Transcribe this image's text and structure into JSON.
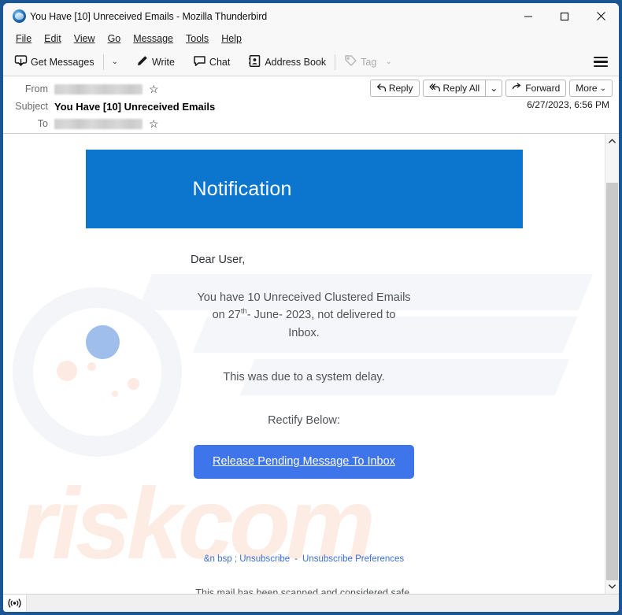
{
  "window": {
    "title": "You Have [10] Unreceived Emails - Mozilla Thunderbird",
    "app_icon": "thunderbird-icon",
    "controls": {
      "minimize": "minimize-icon",
      "maximize": "maximize-icon",
      "close": "close-icon"
    }
  },
  "menubar": {
    "items": [
      {
        "label": "File"
      },
      {
        "label": "Edit"
      },
      {
        "label": "View"
      },
      {
        "label": "Go"
      },
      {
        "label": "Message"
      },
      {
        "label": "Tools"
      },
      {
        "label": "Help"
      }
    ]
  },
  "toolbar": {
    "get_messages": "Get Messages",
    "get_messages_caret": "⌄",
    "write": "Write",
    "chat": "Chat",
    "address_book": "Address Book",
    "tag": "Tag",
    "tag_caret": "⌄",
    "app_menu": "hamburger-menu"
  },
  "message_header": {
    "from_label": "From",
    "from_value": "",
    "subject_label": "Subject",
    "subject_value": "You Have [10] Unreceived Emails",
    "to_label": "To",
    "to_value": "",
    "date": "6/27/2023, 6:56 PM",
    "actions": {
      "reply": "Reply",
      "reply_all": "Reply All",
      "reply_all_caret": "⌄",
      "forward": "Forward",
      "more": "More",
      "more_caret": "⌄"
    }
  },
  "email": {
    "banner_title": "Notification",
    "banner_color": "#0c76ce",
    "greeting": "Dear User,",
    "body_line_1": "You have 10 Unreceived Clustered Emails",
    "body_line_2_pre": "on 27",
    "body_line_2_sup": "th",
    "body_line_2_post": "- June- 2023, not delivered to",
    "body_line_3": "Inbox.",
    "delay_note": "This was due to a system delay.",
    "rectify_text": "Rectify Below:",
    "cta_label": "Release Pending Message To Inbox",
    "cta_color": "#3f75ea",
    "footer": {
      "unsubscribe": "&n bsp ; Unsubscribe",
      "separator": "-",
      "preferences": "Unsubscribe Preferences",
      "scan_note": "This mail has been scanned and considered safe."
    },
    "watermark_text": "riskcom"
  },
  "scrollbar": {
    "up_arrow": "⌃",
    "down_arrow": "⌄"
  },
  "statusbar": {
    "connection_icon": "broadcast-icon",
    "text": ""
  }
}
